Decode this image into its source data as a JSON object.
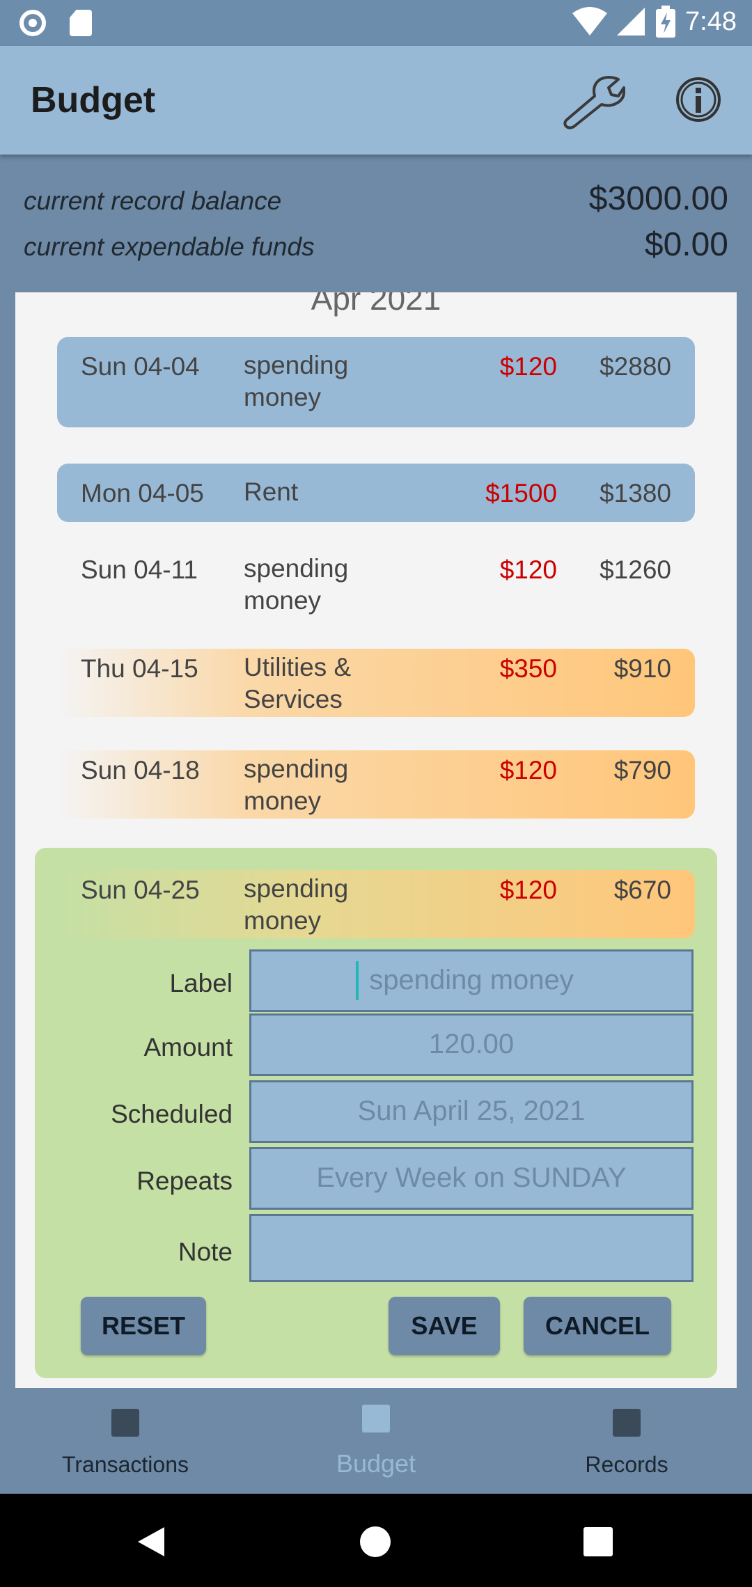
{
  "status_bar": {
    "time": "7:48"
  },
  "app_bar": {
    "title": "Budget"
  },
  "balance": {
    "record_label": "current record balance",
    "record_value": "$3000.00",
    "funds_label": "current expendable funds",
    "funds_value": "$0.00"
  },
  "month": "Apr 2021",
  "rows": [
    {
      "date": "Sun 04-04",
      "label": "spending money",
      "amount": "$120",
      "balance": "$2880"
    },
    {
      "date": "Mon 04-05",
      "label": "Rent",
      "amount": "$1500",
      "balance": "$1380"
    },
    {
      "date": "Sun 04-11",
      "label": "spending money",
      "amount": "$120",
      "balance": "$1260"
    },
    {
      "date": "Thu 04-15",
      "label": "Utilities & Services",
      "amount": "$350",
      "balance": "$910"
    },
    {
      "date": "Sun 04-18",
      "label": "spending money",
      "amount": "$120",
      "balance": "$790"
    },
    {
      "date": "Sun 04-25",
      "label": "spending money",
      "amount": "$120",
      "balance": "$670"
    }
  ],
  "edit_form": {
    "label_field": {
      "label": "Label",
      "value": "spending money"
    },
    "amount_field": {
      "label": "Amount",
      "value": "120.00"
    },
    "scheduled_field": {
      "label": "Scheduled",
      "value": "Sun April 25, 2021"
    },
    "repeats_field": {
      "label": "Repeats",
      "value": "Every Week on SUNDAY"
    },
    "note_field": {
      "label": "Note",
      "value": ""
    },
    "reset_label": "RESET",
    "save_label": "SAVE",
    "cancel_label": "CANCEL"
  },
  "bottom_nav": {
    "items": [
      {
        "label": "Transactions"
      },
      {
        "label": "Budget"
      },
      {
        "label": "Records"
      }
    ],
    "active": "Budget"
  },
  "colors": {
    "app_bar": "#98b9d6",
    "header": "#6e8aa6",
    "negative_amount": "#cc0000",
    "edit_panel": "#c5e0a5",
    "highlight_orange": "#ffc67a"
  },
  "icons": [
    "record-icon",
    "sd-card-icon",
    "wifi-icon",
    "signal-icon",
    "battery-icon",
    "wrench-icon",
    "info-icon",
    "back-icon",
    "home-icon",
    "recents-icon"
  ]
}
